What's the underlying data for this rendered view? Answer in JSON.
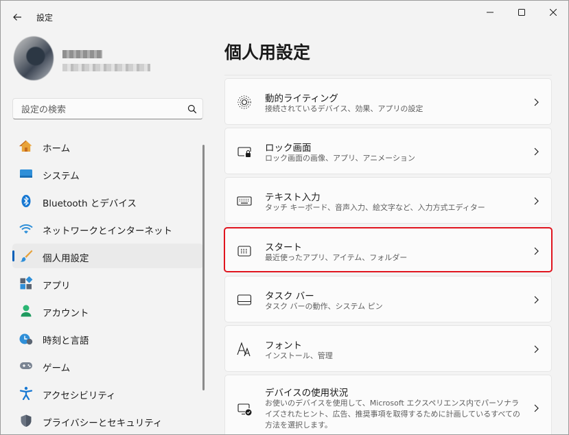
{
  "window": {
    "title": "設定"
  },
  "search": {
    "placeholder": "設定の検索"
  },
  "nav": {
    "items": [
      {
        "label": "ホーム",
        "icon": "home-icon"
      },
      {
        "label": "システム",
        "icon": "system-icon"
      },
      {
        "label": "Bluetooth とデバイス",
        "icon": "bluetooth-icon"
      },
      {
        "label": "ネットワークとインターネット",
        "icon": "wifi-icon"
      },
      {
        "label": "個人用設定",
        "icon": "brush-icon",
        "selected": true
      },
      {
        "label": "アプリ",
        "icon": "apps-icon"
      },
      {
        "label": "アカウント",
        "icon": "account-icon"
      },
      {
        "label": "時刻と言語",
        "icon": "time-language-icon"
      },
      {
        "label": "ゲーム",
        "icon": "gamepad-icon"
      },
      {
        "label": "アクセシビリティ",
        "icon": "accessibility-icon"
      },
      {
        "label": "プライバシーとセキュリティ",
        "icon": "shield-icon"
      }
    ]
  },
  "main": {
    "title": "個人用設定",
    "cards": [
      {
        "title": "動的ライティング",
        "desc": "接続されているデバイス、効果、アプリの設定",
        "icon": "dynamic-lighting-icon"
      },
      {
        "title": "ロック画面",
        "desc": "ロック画面の画像、アプリ、アニメーション",
        "icon": "lock-screen-icon"
      },
      {
        "title": "テキスト入力",
        "desc": "タッチ キーボード、音声入力、絵文字など、入力方式エディター",
        "icon": "keyboard-icon"
      },
      {
        "title": "スタート",
        "desc": "最近使ったアプリ、アイテム、フォルダー",
        "icon": "start-menu-icon",
        "highlighted": true
      },
      {
        "title": "タスク バー",
        "desc": "タスク バーの動作、システム ピン",
        "icon": "taskbar-icon"
      },
      {
        "title": "フォント",
        "desc": "インストール、管理",
        "icon": "fonts-icon"
      },
      {
        "title": "デバイスの使用状況",
        "desc": "お使いのデバイスを使用して、Microsoft エクスペリエンス内でパーソナライズされたヒント、広告、推奨事項を取得するために計画しているすべての方法を選択します。",
        "icon": "device-usage-icon"
      }
    ]
  },
  "colors": {
    "accent": "#005fb8",
    "highlight_border": "#e0141e",
    "background": "#f3f3f3",
    "card": "#fbfbfb"
  }
}
